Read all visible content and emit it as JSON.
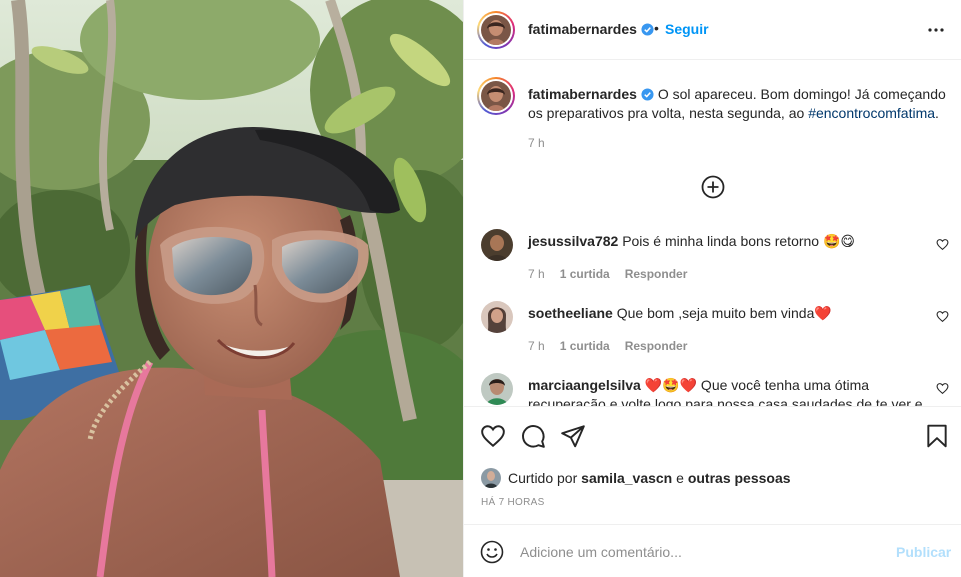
{
  "post": {
    "photo": {
      "icon": "selfie-photo"
    },
    "header": {
      "username": "fatimabernardes",
      "separator": "•",
      "follow_label": "Seguir",
      "more_icon": "more-horizontal-icon"
    },
    "caption": {
      "username": "fatimabernardes",
      "text": "O sol apareceu. Bom domingo! Já começando os preparativos pra volta, nesta segunda, ao",
      "hashtag": "#encontrocomfatima",
      "after_hashtag": ".",
      "time": "7 h"
    },
    "load_more_icon": "plus-circle-icon",
    "comments": [
      {
        "username": "jesussilva782",
        "text": "Pois é minha linda bons retorno 🤩😋",
        "time": "7 h",
        "likes": "1 curtida",
        "reply": "Responder"
      },
      {
        "username": "soetheeliane",
        "text": "Que bom ,seja muito bem vinda❤️",
        "time": "7 h",
        "likes": "1 curtida",
        "reply": "Responder"
      },
      {
        "username": "marciaangelsilva",
        "text": "❤️🤩❤️ Que você tenha uma ótima recuperação e volte logo para nossa casa saudades de te ver e",
        "time": "",
        "likes": "",
        "reply": ""
      }
    ],
    "actions": {
      "like_icon": "heart-icon",
      "comment_icon": "comment-icon",
      "share_icon": "send-icon",
      "save_icon": "bookmark-icon"
    },
    "likes": {
      "prefix": "Curtido por",
      "user": "samila_vascn",
      "middle": "e",
      "suffix": "outras pessoas"
    },
    "posted_time": "HÁ 7 HORAS",
    "add_comment": {
      "placeholder": "Adicione um comentário...",
      "publish_label": "Publicar"
    }
  },
  "colors": {
    "link_blue": "#0095f6",
    "publish_disabled": "#b2dffc",
    "hashtag": "#00376b",
    "muted": "#8e8e8e",
    "verified": "#3897f0"
  }
}
